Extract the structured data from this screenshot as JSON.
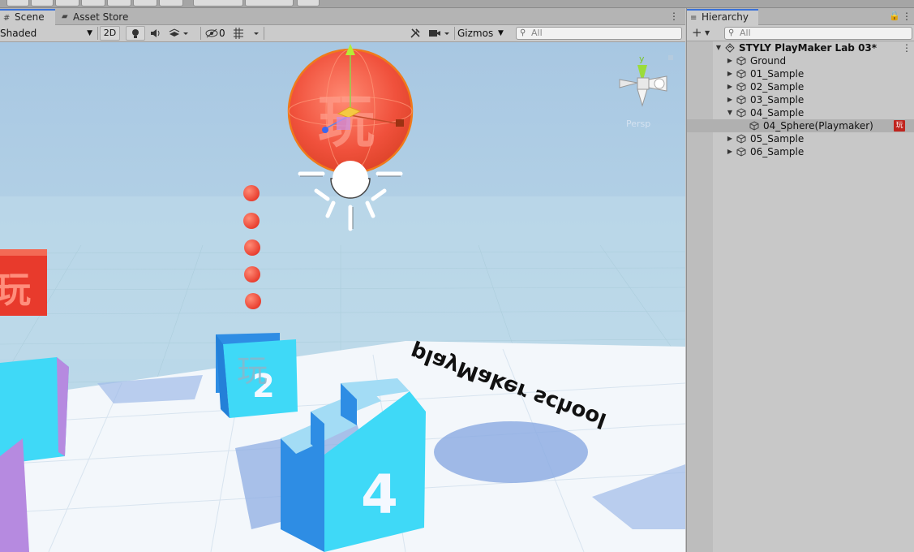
{
  "scene_tabs": [
    {
      "label": "Scene",
      "active": true
    },
    {
      "label": "Asset Store",
      "active": false
    }
  ],
  "scene_toolbar": {
    "draw_mode": "Shaded",
    "two_d": "2D",
    "hidden_count": "0",
    "gizmos": "Gizmos",
    "search_placeholder": "All"
  },
  "viewport": {
    "persp_label": "Persp",
    "gizmo_axis_y": "y",
    "floor_text": "playMaker school",
    "block_numbers": [
      "2",
      "4"
    ],
    "logo_glyph": "玩"
  },
  "hierarchy": {
    "tab_label": "Hierarchy",
    "search_placeholder": "All",
    "root": "STYLY PlayMaker Lab 03*",
    "items": [
      {
        "label": "Ground",
        "expanded": false,
        "depth": 1
      },
      {
        "label": "01_Sample",
        "expanded": false,
        "depth": 1
      },
      {
        "label": "02_Sample",
        "expanded": false,
        "depth": 1
      },
      {
        "label": "03_Sample",
        "expanded": false,
        "depth": 1
      },
      {
        "label": "04_Sample",
        "expanded": true,
        "depth": 1
      },
      {
        "label": "04_Sphere(Playmaker)",
        "expanded": null,
        "depth": 2,
        "selected": true,
        "badge": "玩"
      },
      {
        "label": "05_Sample",
        "expanded": false,
        "depth": 1
      },
      {
        "label": "06_Sample",
        "expanded": false,
        "depth": 1
      }
    ]
  },
  "colors": {
    "accent": "#3a72d8",
    "sky": "#a6c6e0",
    "floor": "#f4f7fb",
    "block": "#3fd9f7",
    "sphere": "#f0513c"
  }
}
